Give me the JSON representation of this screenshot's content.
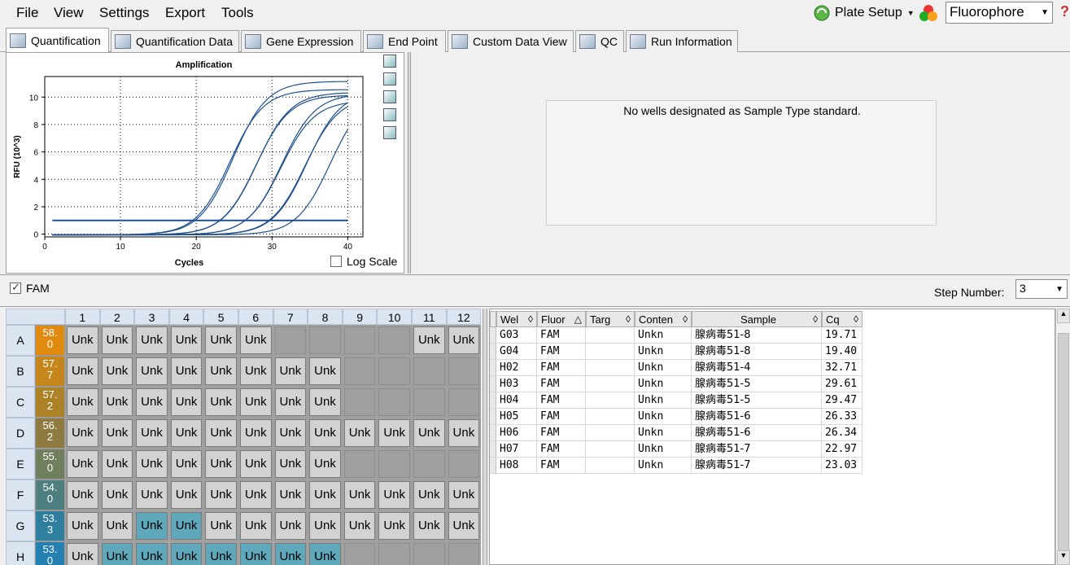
{
  "menu": [
    "File",
    "View",
    "Settings",
    "Export",
    "Tools"
  ],
  "toolbar": {
    "plate_setup": "Plate Setup",
    "fluorophore": "Fluorophore"
  },
  "tabs": [
    {
      "label": "Quantification"
    },
    {
      "label": "Quantification Data"
    },
    {
      "label": "Gene Expression"
    },
    {
      "label": "End Point"
    },
    {
      "label": "Custom Data View"
    },
    {
      "label": "QC"
    },
    {
      "label": "Run Information"
    }
  ],
  "chart_data": {
    "type": "line",
    "title": "Amplification",
    "xlabel": "Cycles",
    "ylabel": "RFU (10^3)",
    "xlim": [
      0,
      42
    ],
    "ylim": [
      -0.2,
      11.5
    ],
    "xticks": [
      0,
      10,
      20,
      30,
      40
    ],
    "yticks": [
      0,
      2,
      4,
      6,
      8,
      10
    ],
    "grid": true,
    "threshold": 1.0,
    "series": [
      {
        "cq": 19.71,
        "plateau": 11.2
      },
      {
        "cq": 19.4,
        "plateau": 10.6
      },
      {
        "cq": 32.71,
        "plateau": 10.4
      },
      {
        "cq": 29.61,
        "plateau": 10.5
      },
      {
        "cq": 29.47,
        "plateau": 10.1
      },
      {
        "cq": 26.33,
        "plateau": 10.3
      },
      {
        "cq": 26.34,
        "plateau": 9.8
      },
      {
        "cq": 22.97,
        "plateau": 10.2
      },
      {
        "cq": 23.03,
        "plateau": 10.4
      }
    ]
  },
  "log_scale_label": "Log Scale",
  "standard_message": "No wells designated as Sample Type standard.",
  "fam_label": "FAM",
  "step_label": "Step Number:",
  "step_value": "3",
  "plate": {
    "columns": [
      "1",
      "2",
      "3",
      "4",
      "5",
      "6",
      "7",
      "8",
      "9",
      "10",
      "11",
      "12"
    ],
    "rows": [
      {
        "label": "A",
        "temp": "58.\n0",
        "color": "#e08a10",
        "wells": [
          "Unk",
          "Unk",
          "Unk",
          "Unk",
          "Unk",
          "Unk",
          "",
          "",
          "",
          "",
          "Unk",
          "Unk"
        ]
      },
      {
        "label": "B",
        "temp": "57.\n7",
        "color": "#c7861c",
        "wells": [
          "Unk",
          "Unk",
          "Unk",
          "Unk",
          "Unk",
          "Unk",
          "Unk",
          "Unk",
          "",
          "",
          "",
          ""
        ]
      },
      {
        "label": "C",
        "temp": "57.\n2",
        "color": "#ad8227",
        "wells": [
          "Unk",
          "Unk",
          "Unk",
          "Unk",
          "Unk",
          "Unk",
          "Unk",
          "Unk",
          "",
          "",
          "",
          ""
        ]
      },
      {
        "label": "D",
        "temp": "56.\n2",
        "color": "#8f7b3f",
        "wells": [
          "Unk",
          "Unk",
          "Unk",
          "Unk",
          "Unk",
          "Unk",
          "Unk",
          "Unk",
          "Unk",
          "Unk",
          "Unk",
          "Unk"
        ]
      },
      {
        "label": "E",
        "temp": "55.\n0",
        "color": "#707e5e",
        "wells": [
          "Unk",
          "Unk",
          "Unk",
          "Unk",
          "Unk",
          "Unk",
          "Unk",
          "Unk",
          "",
          "",
          "",
          ""
        ]
      },
      {
        "label": "F",
        "temp": "54.\n0",
        "color": "#4d7f80",
        "wells": [
          "Unk",
          "Unk",
          "Unk",
          "Unk",
          "Unk",
          "Unk",
          "Unk",
          "Unk",
          "Unk",
          "Unk",
          "Unk",
          "Unk"
        ]
      },
      {
        "label": "G",
        "temp": "53.\n3",
        "color": "#2f7f9f",
        "wells": [
          "Unk",
          "Unk",
          "Unk",
          "Unk",
          "Unk",
          "Unk",
          "Unk",
          "Unk",
          "Unk",
          "Unk",
          "Unk",
          "Unk"
        ]
      },
      {
        "label": "H",
        "temp": "53.\n0",
        "color": "#2480b0",
        "wells": [
          "Unk",
          "Unk",
          "Unk",
          "Unk",
          "Unk",
          "Unk",
          "Unk",
          "Unk",
          "",
          "",
          "",
          ""
        ]
      }
    ],
    "selected": [
      "G3",
      "G4",
      "H2",
      "H3",
      "H4",
      "H5",
      "H6",
      "H7",
      "H8"
    ]
  },
  "results": {
    "headers": [
      "Wel\nl",
      "Fluor",
      "Targ\net",
      "Conten\nt",
      "Sample",
      "Cq"
    ],
    "rows": [
      [
        "G03",
        "FAM",
        "",
        "Unkn",
        "腺病毒51-8",
        "19.71"
      ],
      [
        "G04",
        "FAM",
        "",
        "Unkn",
        "腺病毒51-8",
        "19.40"
      ],
      [
        "H02",
        "FAM",
        "",
        "Unkn",
        "腺病毒51-4",
        "32.71"
      ],
      [
        "H03",
        "FAM",
        "",
        "Unkn",
        "腺病毒51-5",
        "29.61"
      ],
      [
        "H04",
        "FAM",
        "",
        "Unkn",
        "腺病毒51-5",
        "29.47"
      ],
      [
        "H05",
        "FAM",
        "",
        "Unkn",
        "腺病毒51-6",
        "26.33"
      ],
      [
        "H06",
        "FAM",
        "",
        "Unkn",
        "腺病毒51-6",
        "26.34"
      ],
      [
        "H07",
        "FAM",
        "",
        "Unkn",
        "腺病毒51-7",
        "22.97"
      ],
      [
        "H08",
        "FAM",
        "",
        "Unkn",
        "腺病毒51-7",
        "23.03"
      ]
    ]
  }
}
